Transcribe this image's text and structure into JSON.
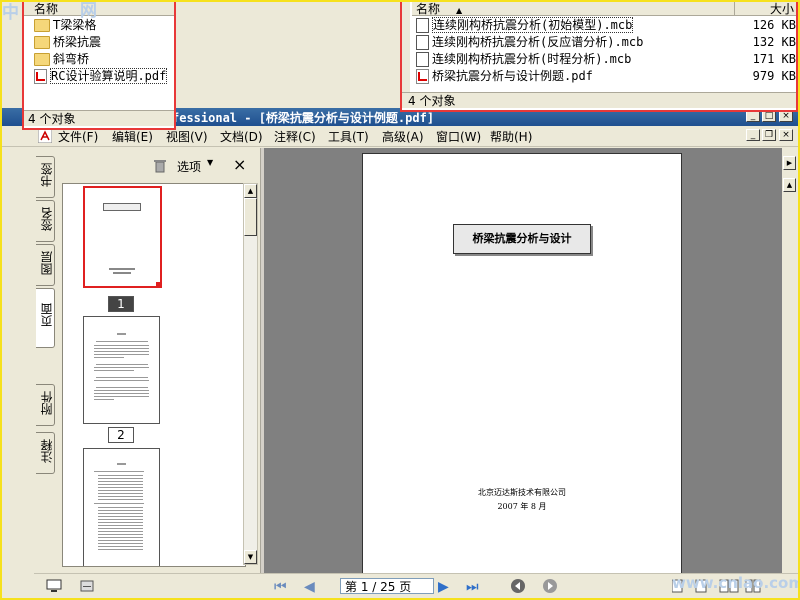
{
  "adobe": {
    "title": "fessional - [桥梁抗震分析与设计例题.pdf]",
    "menu": [
      "文件(F)",
      "编辑(E)",
      "视图(V)",
      "文档(D)",
      "注释(C)",
      "工具(T)",
      "高级(A)",
      "窗口(W)",
      "帮助(H)"
    ],
    "side_tabs": [
      "书签",
      "签名",
      "图层",
      "页面",
      "附件",
      "注释"
    ],
    "thumb_options_label": "选项",
    "thumb_close": "×",
    "page_labels": [
      "1",
      "2"
    ],
    "thumb1_title": "桥梁抗震分析与设计",
    "doc_title": "桥梁抗震分析与设计",
    "doc_company": "北京迈达斯技术有限公司",
    "doc_date": "2007 年 8 月",
    "page_indicator": "第 1 / 25 页"
  },
  "explorer_left": {
    "column": "名称",
    "items": [
      {
        "name": "T梁梁格",
        "type": "folder"
      },
      {
        "name": "桥梁抗震",
        "type": "folder"
      },
      {
        "name": "斜弯桥",
        "type": "folder"
      },
      {
        "name": "RC设计验算说明.pdf",
        "type": "pdf"
      }
    ],
    "status": "4 个对象"
  },
  "explorer_right": {
    "col_name": "名称",
    "col_size": "大小",
    "items": [
      {
        "name": "连续刚构桥抗震分析(初始模型).mcb",
        "size": "126 KB",
        "type": "mcb"
      },
      {
        "name": "连续刚构桥抗震分析(反应谱分析).mcb",
        "size": "132 KB",
        "type": "mcb"
      },
      {
        "name": "连续刚构桥抗震分析(时程分析).mcb",
        "size": "171 KB",
        "type": "mcb"
      },
      {
        "name": "桥梁抗震分析与设计例题.pdf",
        "size": "979 KB",
        "type": "pdf"
      }
    ],
    "status": "4 个对象"
  },
  "watermarks": {
    "top_left": "中",
    "top_left2": "网",
    "bottom_right": "www.cnlao.com"
  },
  "colors": {
    "title_bar": "#1f4f8f",
    "doc_bg": "#808080",
    "frame": "#f6e11c",
    "explorer_border": "#e83838"
  }
}
